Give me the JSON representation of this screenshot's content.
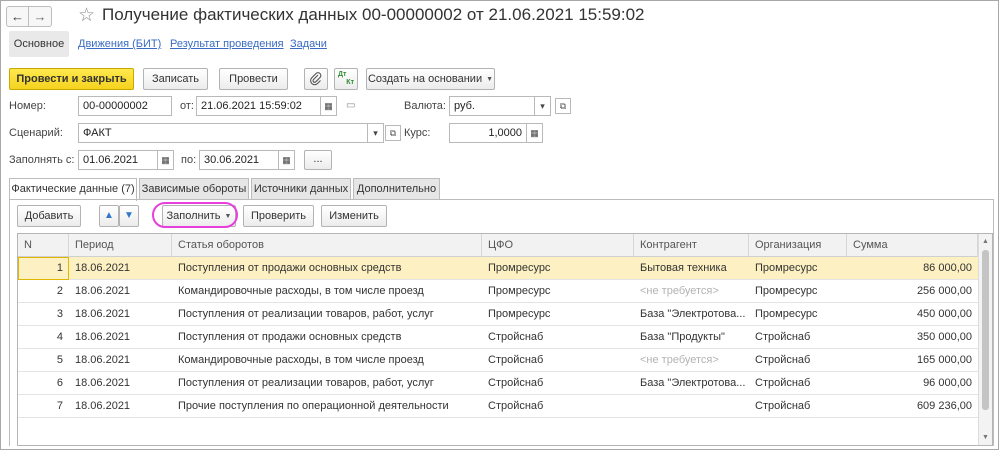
{
  "title": "Получение фактических данных 00-00000002 от 21.06.2021 15:59:02",
  "nav": {
    "back_glyph": "←",
    "forward_glyph": "→",
    "star_glyph": "☆"
  },
  "section_tabs": [
    "Основное",
    "Движения (БИТ)",
    "Результат проведения",
    "Задачи"
  ],
  "toolbar": {
    "post_close": "Провести и закрыть",
    "save": "Записать",
    "post": "Провести",
    "create_based": "Создать на основании",
    "dtkt_top": "Дт",
    "dtkt_bottom": "Кт"
  },
  "form": {
    "number_label": "Номер:",
    "number_value": "00-00000002",
    "from_label": "от:",
    "from_value": "21.06.2021 15:59:02",
    "currency_label": "Валюта:",
    "currency_value": "руб.",
    "scenario_label": "Сценарий:",
    "scenario_value": "ФАКТ",
    "rate_label": "Курс:",
    "rate_value": "1,0000",
    "fill_from_label": "Заполнять с:",
    "fill_from_value": "01.06.2021",
    "to_label": "по:",
    "to_value": "30.06.2021",
    "ellipsis": "..."
  },
  "content_tabs": [
    "Фактические данные (7)",
    "Зависимые обороты",
    "Источники данных",
    "Дополнительно"
  ],
  "table_toolbar": {
    "add": "Добавить",
    "fill": "Заполнить",
    "check": "Проверить",
    "change": "Изменить"
  },
  "table": {
    "columns": [
      "N",
      "Период",
      "Статья оборотов",
      "ЦФО",
      "Контрагент",
      "Организация",
      "Сумма"
    ],
    "rows": [
      [
        "1",
        "18.06.2021",
        "Поступления от продажи основных средств",
        "Промресурс",
        "Бытовая техника",
        "Промресурс",
        "86 000,00"
      ],
      [
        "2",
        "18.06.2021",
        "Командировочные расходы, в том числе проезд",
        "Промресурс",
        "<не требуется>",
        "Промресурс",
        "256 000,00"
      ],
      [
        "3",
        "18.06.2021",
        "Поступления от реализации товаров, работ, услуг",
        "Промресурс",
        "База \"Электротова...",
        "Промресурс",
        "450 000,00"
      ],
      [
        "4",
        "18.06.2021",
        "Поступления от продажи основных средств",
        "Стройснаб",
        "База \"Продукты\"",
        "Стройснаб",
        "350 000,00"
      ],
      [
        "5",
        "18.06.2021",
        "Командировочные расходы, в том числе проезд",
        "Стройснаб",
        "<не требуется>",
        "Стройснаб",
        "165 000,00"
      ],
      [
        "6",
        "18.06.2021",
        "Поступления от реализации товаров, работ, услуг",
        "Стройснаб",
        "База \"Электротова...",
        "Стройснаб",
        "96 000,00"
      ],
      [
        "7",
        "18.06.2021",
        "Прочие поступления по операционной деятельности",
        "Стройснаб",
        "",
        "Стройснаб",
        "609 236,00"
      ]
    ]
  },
  "colors": {
    "accent_yellow": "#f5d21f",
    "link_blue": "#3a6bc2",
    "selected_row": "#fdf1c3",
    "highlight_ring": "#e63fdc"
  }
}
